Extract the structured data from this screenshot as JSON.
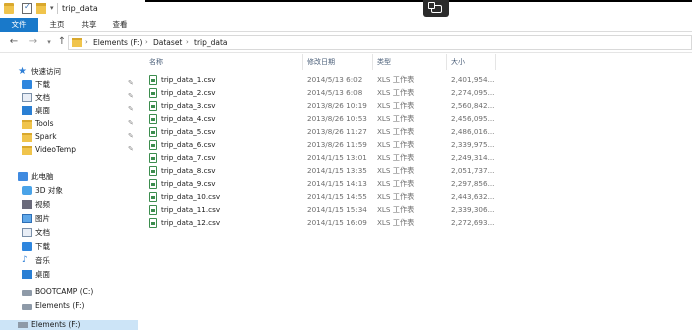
{
  "window": {
    "title": "trip_data"
  },
  "ribbon": {
    "tabs": [
      "文件",
      "主页",
      "共享",
      "查看"
    ]
  },
  "address": {
    "crumbs": [
      "Elements (F:)",
      "Dataset",
      "trip_data"
    ]
  },
  "nav": {
    "quick_access": "快速访问",
    "pinned": [
      {
        "label": "下载",
        "icon": "download-icon"
      },
      {
        "label": "文档",
        "icon": "document-icon"
      },
      {
        "label": "桌面",
        "icon": "desktop-icon"
      },
      {
        "label": "Tools",
        "icon": "folder-icon"
      },
      {
        "label": "Spark",
        "icon": "folder-icon"
      },
      {
        "label": "VideoTemp",
        "icon": "folder-icon"
      }
    ],
    "this_pc": "此电脑",
    "pc_items": [
      {
        "label": "3D 对象",
        "icon": "3d-objects-icon"
      },
      {
        "label": "视频",
        "icon": "video-icon"
      },
      {
        "label": "图片",
        "icon": "pictures-icon"
      },
      {
        "label": "文档",
        "icon": "document-icon"
      },
      {
        "label": "下载",
        "icon": "download-icon"
      },
      {
        "label": "音乐",
        "icon": "music-icon"
      },
      {
        "label": "桌面",
        "icon": "desktop-icon"
      },
      {
        "label": "BOOTCAMP (C:)",
        "icon": "drive-icon"
      },
      {
        "label": "Elements (F:)",
        "icon": "drive-icon"
      }
    ],
    "bottom_item": "Elements (F:)"
  },
  "columns": {
    "name": "名称",
    "date": "修改日期",
    "type": "类型",
    "size": "大小"
  },
  "files": [
    {
      "name": "trip_data_1.csv",
      "date": "2014/5/13 6:02",
      "type": "XLS 工作表",
      "size": "2,401,954..."
    },
    {
      "name": "trip_data_2.csv",
      "date": "2014/5/13 6:08",
      "type": "XLS 工作表",
      "size": "2,274,095..."
    },
    {
      "name": "trip_data_3.csv",
      "date": "2013/8/26 10:19",
      "type": "XLS 工作表",
      "size": "2,560,842..."
    },
    {
      "name": "trip_data_4.csv",
      "date": "2013/8/26 10:53",
      "type": "XLS 工作表",
      "size": "2,456,095..."
    },
    {
      "name": "trip_data_5.csv",
      "date": "2013/8/26 11:27",
      "type": "XLS 工作表",
      "size": "2,486,016..."
    },
    {
      "name": "trip_data_6.csv",
      "date": "2013/8/26 11:59",
      "type": "XLS 工作表",
      "size": "2,339,975..."
    },
    {
      "name": "trip_data_7.csv",
      "date": "2014/1/15 13:01",
      "type": "XLS 工作表",
      "size": "2,249,314..."
    },
    {
      "name": "trip_data_8.csv",
      "date": "2014/1/15 13:35",
      "type": "XLS 工作表",
      "size": "2,051,737..."
    },
    {
      "name": "trip_data_9.csv",
      "date": "2014/1/15 14:13",
      "type": "XLS 工作表",
      "size": "2,297,856..."
    },
    {
      "name": "trip_data_10.csv",
      "date": "2014/1/15 14:55",
      "type": "XLS 工作表",
      "size": "2,443,632..."
    },
    {
      "name": "trip_data_11.csv",
      "date": "2014/1/15 15:34",
      "type": "XLS 工作表",
      "size": "2,339,306..."
    },
    {
      "name": "trip_data_12.csv",
      "date": "2014/1/15 16:09",
      "type": "XLS 工作表",
      "size": "2,272,693..."
    }
  ]
}
